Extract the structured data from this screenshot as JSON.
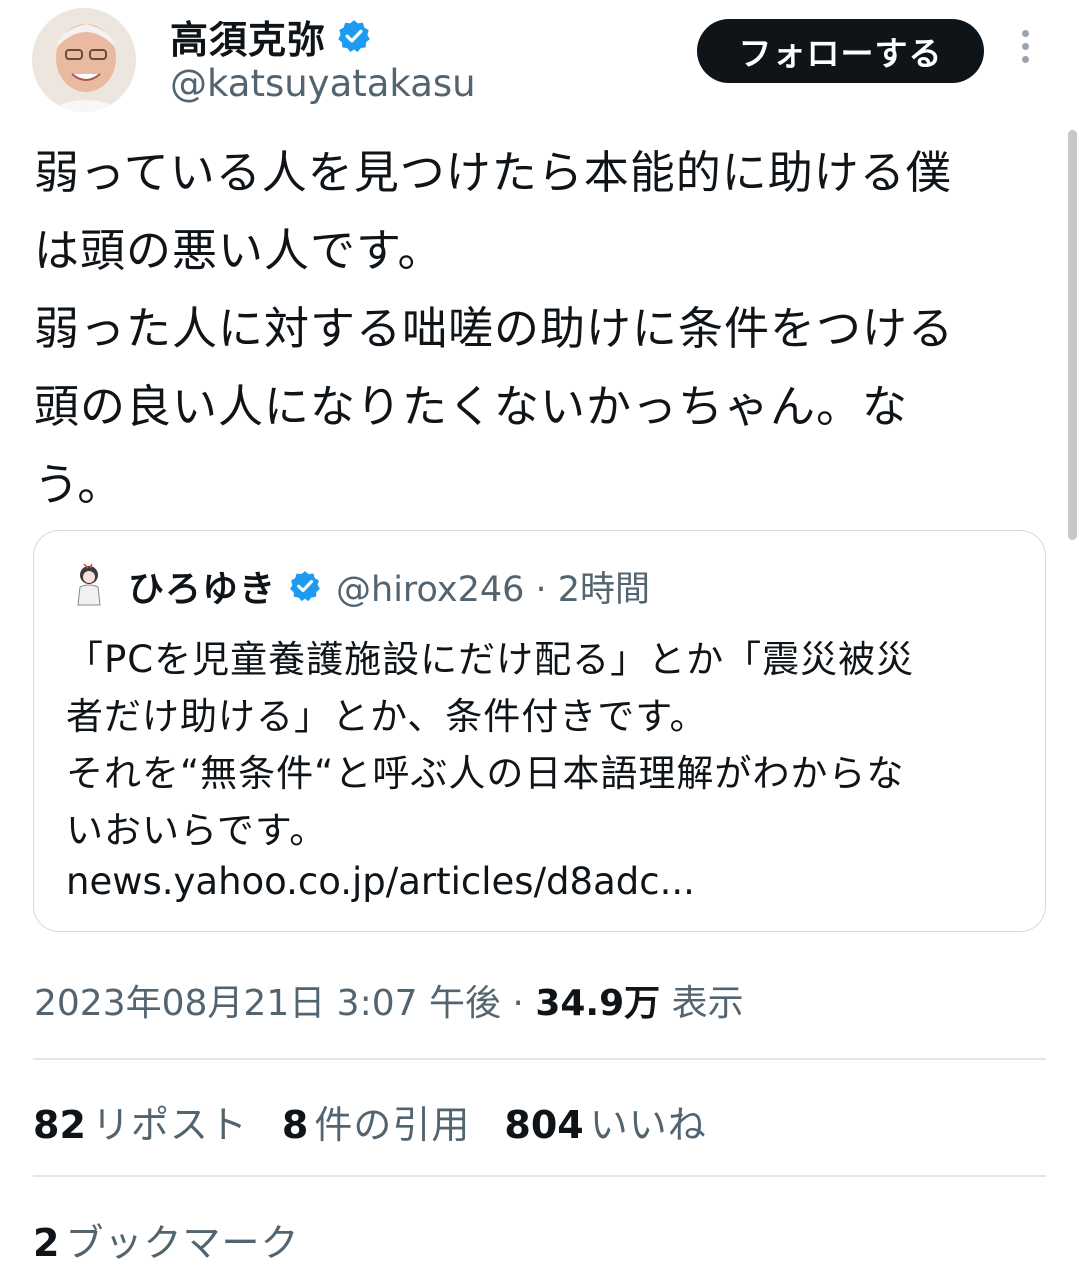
{
  "author": {
    "name": "高須克弥",
    "handle": "@katsuyatakasu",
    "verified_color": "#1d9bf0"
  },
  "follow_label": "フォローする",
  "tweet_text": "弱っている人を見つけたら本能的に助ける僕\nは頭の悪い人です。\n弱った人に対する咄嗟の助けに条件をつける\n頭の良い人になりたくないかっちゃん。な\nう。",
  "quote": {
    "name": "ひろゆき",
    "handle_time": "@hirox246 · 2時間",
    "text": "「PCを児童養護施設にだけ配る」とか「震災被災\n者だけ助ける」とか、条件付きです。\nそれを“無条件“と呼ぶ人の日本語理解がわからな\nいおいらです。",
    "link": "news.yahoo.co.jp/articles/d8adc..."
  },
  "meta": {
    "datetime": "2023年08月21日 3:07 午後",
    "separator": " · ",
    "views": "34.9万",
    "views_label": "表示"
  },
  "stats": {
    "reposts": "82",
    "reposts_label": "リポスト",
    "quotes": "8",
    "quotes_label": "件の引用",
    "likes": "804",
    "likes_label": "いいね",
    "bookmarks": "2",
    "bookmarks_label": "ブックマーク"
  }
}
